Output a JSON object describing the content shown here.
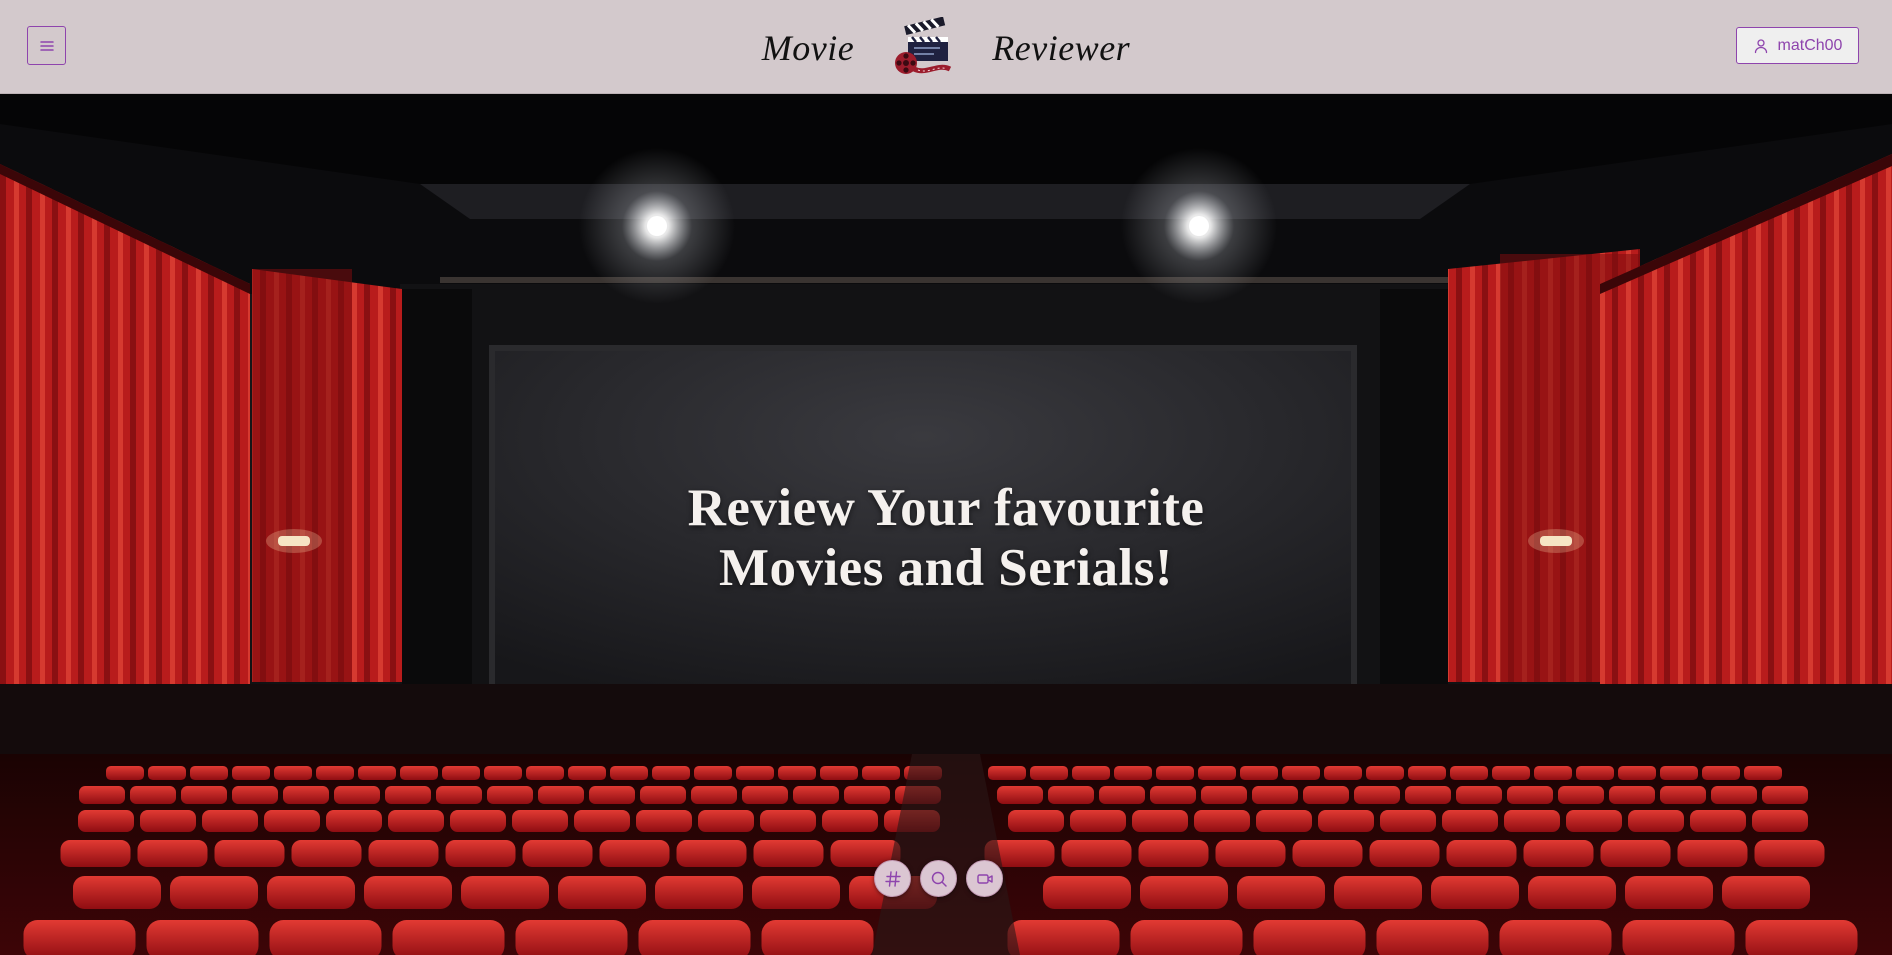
{
  "header": {
    "brand_left": "Movie",
    "brand_right": "Reviewer",
    "logo_icon": "clapperboard-film-reel-icon",
    "menu_icon": "hamburger-menu-icon",
    "account": {
      "icon": "user-icon",
      "username": "matCh00"
    }
  },
  "hero": {
    "title_line1": "Review Your favourite",
    "title_line2": "Movies and Serials!"
  },
  "actions": [
    {
      "icon": "hash-icon"
    },
    {
      "icon": "search-icon"
    },
    {
      "icon": "video-camera-icon"
    }
  ],
  "colors": {
    "header_bg": "#d3c9cc",
    "accent": "#8e44ad",
    "curtain": "#b3191d",
    "seat": "#c41a1f"
  }
}
